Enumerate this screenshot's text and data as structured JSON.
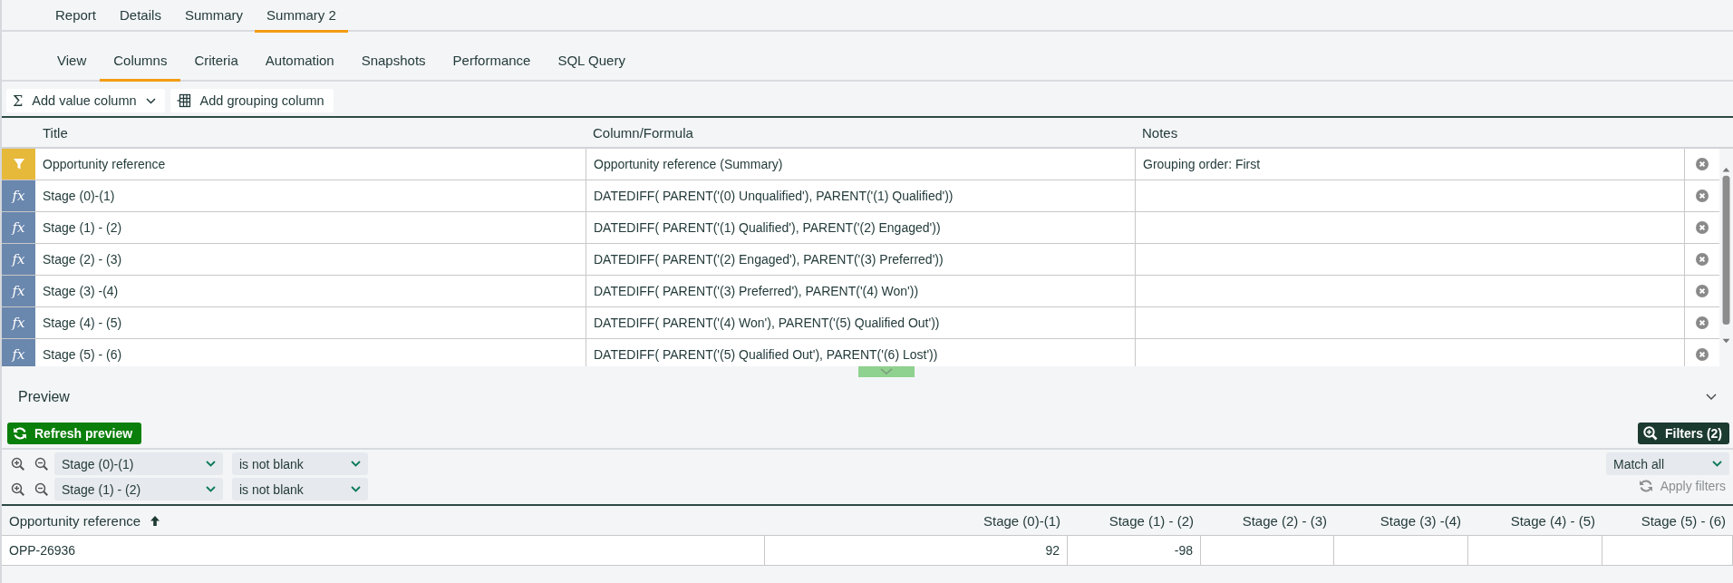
{
  "report_tabs": [
    {
      "label": "Report",
      "selected": false
    },
    {
      "label": "Details",
      "selected": false
    },
    {
      "label": "Summary",
      "selected": false
    },
    {
      "label": "Summary 2",
      "selected": true
    }
  ],
  "section_tabs": [
    {
      "label": "View",
      "selected": false
    },
    {
      "label": "Columns",
      "selected": true
    },
    {
      "label": "Criteria",
      "selected": false
    },
    {
      "label": "Automation",
      "selected": false
    },
    {
      "label": "Snapshots",
      "selected": false
    },
    {
      "label": "Performance",
      "selected": false
    },
    {
      "label": "SQL Query",
      "selected": false
    }
  ],
  "toolbar": [
    {
      "kind": "value",
      "symbol": "Σ",
      "label": "Add value column"
    },
    {
      "kind": "grouping",
      "label": "Add grouping column"
    }
  ],
  "columns_table": {
    "columns": [
      "Title",
      "Column/Formula",
      "Notes"
    ],
    "rows": [
      {
        "kind": "grouping",
        "title": "Opportunity reference",
        "formula": "Opportunity reference (Summary)",
        "notes": "Grouping order: First"
      },
      {
        "kind": "formula",
        "badge": "fx",
        "title": "Stage (0)-(1)",
        "formula": "DATEDIFF( PARENT('(0) Unqualified'), PARENT('(1) Qualified'))"
      },
      {
        "kind": "formula",
        "badge": "fx",
        "title": "Stage (1) - (2)",
        "formula": "DATEDIFF( PARENT('(1) Qualified'), PARENT('(2) Engaged'))"
      },
      {
        "kind": "formula",
        "badge": "fx",
        "title": "Stage (2) - (3)",
        "formula": "DATEDIFF( PARENT('(2) Engaged'), PARENT('(3) Preferred'))"
      },
      {
        "kind": "formula",
        "badge": "fx",
        "title": "Stage (3) -(4)",
        "formula": "DATEDIFF( PARENT('(3) Preferred'), PARENT('(4) Won'))"
      },
      {
        "kind": "formula",
        "badge": "fx",
        "title": "Stage (4) - (5)",
        "formula": "DATEDIFF( PARENT('(4) Won'), PARENT('(5) Qualified Out'))"
      },
      {
        "kind": "formula",
        "badge": "fx",
        "title": "Stage (5) - (6)",
        "formula": "DATEDIFF( PARENT('(5) Qualified Out'), PARENT('(6) Lost'))"
      }
    ]
  },
  "preview": {
    "title": "Preview",
    "refresh_button": "Refresh preview",
    "filters_button": "Filters (2)",
    "filters": [
      {
        "field": "Stage (0)-(1)",
        "operator": "is not blank"
      },
      {
        "field": "Stage (1) - (2)",
        "operator": "is not blank"
      }
    ],
    "match": "Match all",
    "apply_button": {
      "label": "Apply filters",
      "disabled": true
    },
    "table": {
      "columns": [
        {
          "label": "Opportunity reference",
          "sorted_ascending": true
        },
        {
          "label": "Stage (0)-(1)"
        },
        {
          "label": "Stage (1) - (2)"
        },
        {
          "label": "Stage (2) - (3)"
        },
        {
          "label": "Stage (3) -(4)"
        },
        {
          "label": "Stage (4) - (5)"
        },
        {
          "label": "Stage (5) - (6)"
        }
      ],
      "rows": [
        {
          "cells": [
            "OPP-26936",
            "92",
            "-98",
            null,
            null,
            null,
            null
          ]
        }
      ]
    }
  }
}
